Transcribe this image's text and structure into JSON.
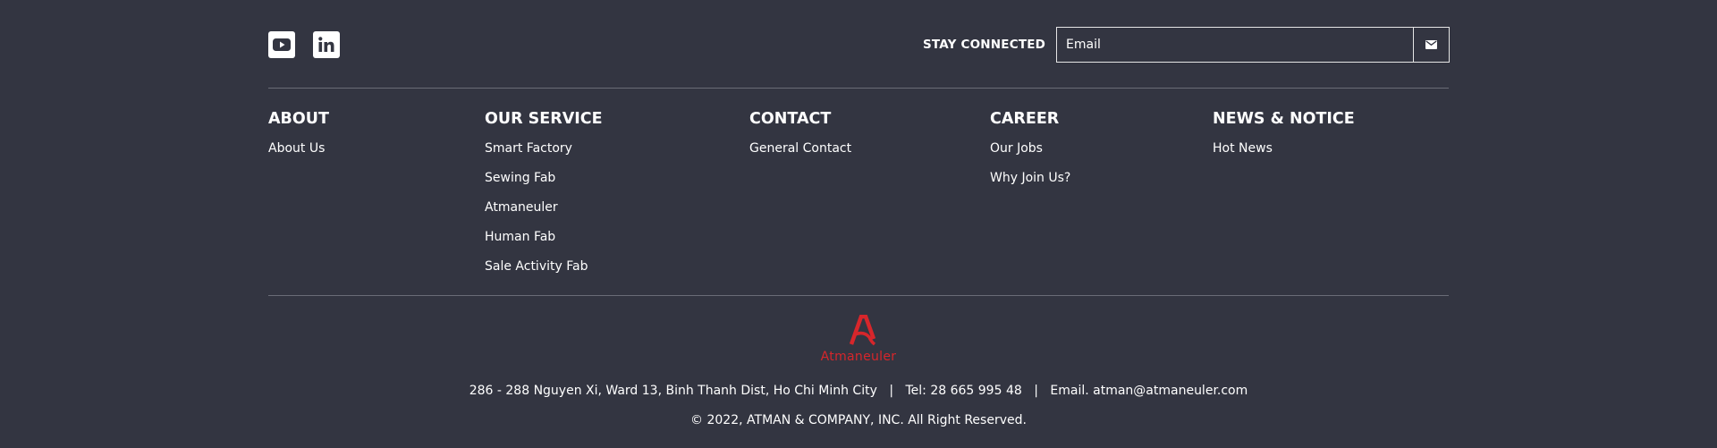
{
  "social": {
    "youtube_icon": "youtube-icon",
    "linkedin_icon": "linkedin-icon"
  },
  "newsletter": {
    "label": "STAY CONNECTED",
    "placeholder": "Email",
    "send_icon": "mail-icon"
  },
  "columns": [
    {
      "heading": "ABOUT",
      "links": [
        "About Us"
      ]
    },
    {
      "heading": "OUR SERVICE",
      "links": [
        "Smart Factory",
        "Sewing Fab",
        "Atmaneuler",
        "Human Fab",
        "Sale Activity Fab"
      ]
    },
    {
      "heading": "CONTACT",
      "links": [
        "General Contact"
      ]
    },
    {
      "heading": "CAREER",
      "links": [
        "Our Jobs",
        "Why Join Us?"
      ]
    },
    {
      "heading": "NEWS & NOTICE",
      "links": [
        "Hot News"
      ]
    }
  ],
  "brand": {
    "logo_text": "Atmaneuler",
    "color": "#d7262b"
  },
  "contact_info": {
    "address": "286 - 288 Nguyen Xi, Ward 13, Binh Thanh Dist, Ho Chi Minh City",
    "separator": "|",
    "phone": "Tel: 28 665 995 48",
    "email": "Email. atman@atmaneuler.com"
  },
  "copyright": "© 2022, ATMAN & COMPANY, INC. All Right Reserved.",
  "colors": {
    "background": "#333541",
    "text": "#ffffff",
    "divider": "#6a6c76"
  }
}
